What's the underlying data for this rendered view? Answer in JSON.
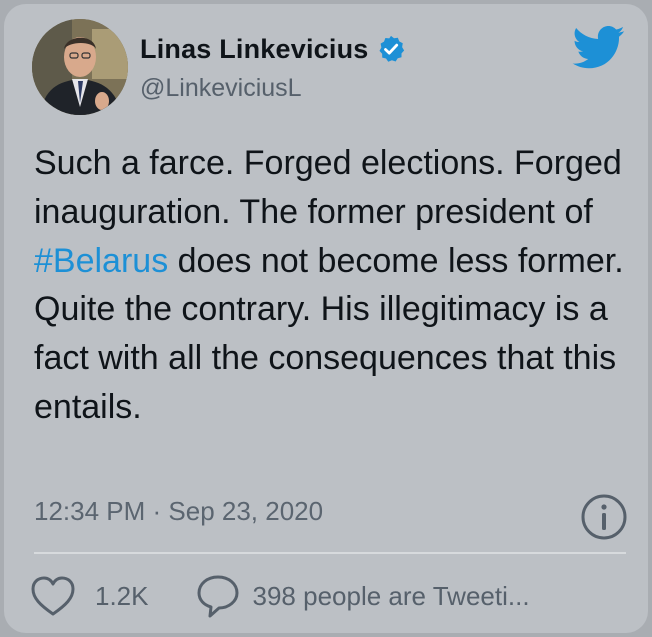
{
  "tweet": {
    "author_name": "Linas Linkevicius",
    "author_handle": "@LinkeviciusL",
    "text_before": "Such a farce. Forged elections. Forged inauguration. The former president of ",
    "hashtag": "#Belarus",
    "text_after": " does not become less former. Quite the contrary. His illegitimacy is a fact with all the consequences that this entails.",
    "timestamp": "12:34 PM · Sep 23, 2020",
    "likes": "1.2K",
    "conversation": "398 people are Tweeti..."
  },
  "icons": {
    "verified": "verified-badge-icon",
    "brand": "twitter-bird-icon",
    "info": "info-icon",
    "like": "heart-icon",
    "reply": "speech-bubble-icon"
  },
  "colors": {
    "card_background": "#bcc0c5",
    "text": "#0f1419",
    "muted": "#56606b",
    "accent": "#1d90d6"
  }
}
